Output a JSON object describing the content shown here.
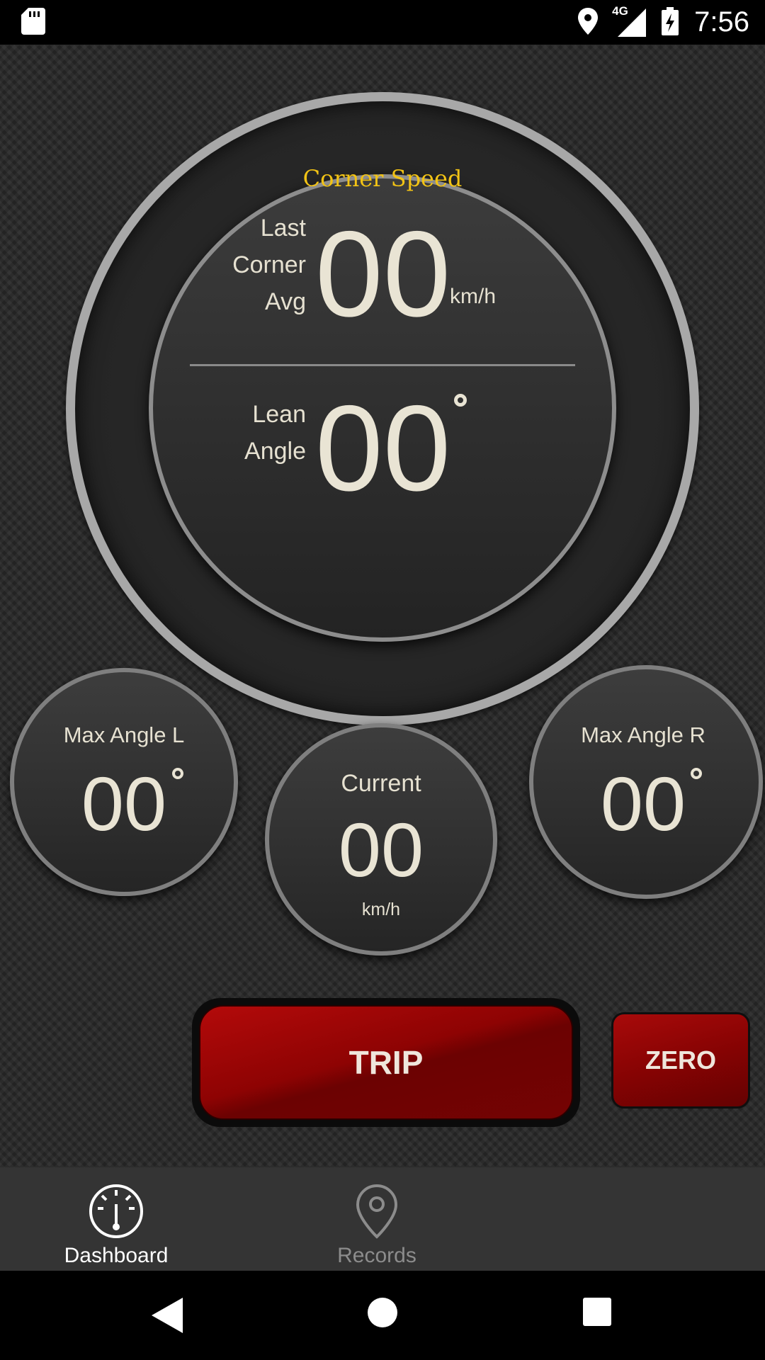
{
  "status_bar": {
    "network": "4G",
    "time": "7:56"
  },
  "corner_speed": {
    "title": "Corner Speed",
    "last_corner_avg": {
      "label_lines": [
        "Last",
        "Corner",
        "Avg"
      ],
      "value": "00",
      "unit": "km/h"
    },
    "lean_angle": {
      "label_lines": [
        "Lean",
        "Angle"
      ],
      "value": "00"
    }
  },
  "gauges": {
    "max_angle_l": {
      "label": "Max Angle L",
      "value": "00"
    },
    "current": {
      "label": "Current",
      "value": "00",
      "unit": "km/h"
    },
    "max_angle_r": {
      "label": "Max Angle R",
      "value": "00"
    }
  },
  "buttons": {
    "trip": "TRIP",
    "zero": "ZERO"
  },
  "bottom_nav": {
    "items": [
      {
        "label": "Dashboard",
        "icon": "gauge-icon",
        "active": true,
        "color": "#ffffff"
      },
      {
        "label": "Records",
        "icon": "map-pin-icon",
        "active": false,
        "color": "#8c8c8c"
      }
    ]
  },
  "colors": {
    "accent_title": "#f2c315",
    "button_red": "#8e0303"
  }
}
